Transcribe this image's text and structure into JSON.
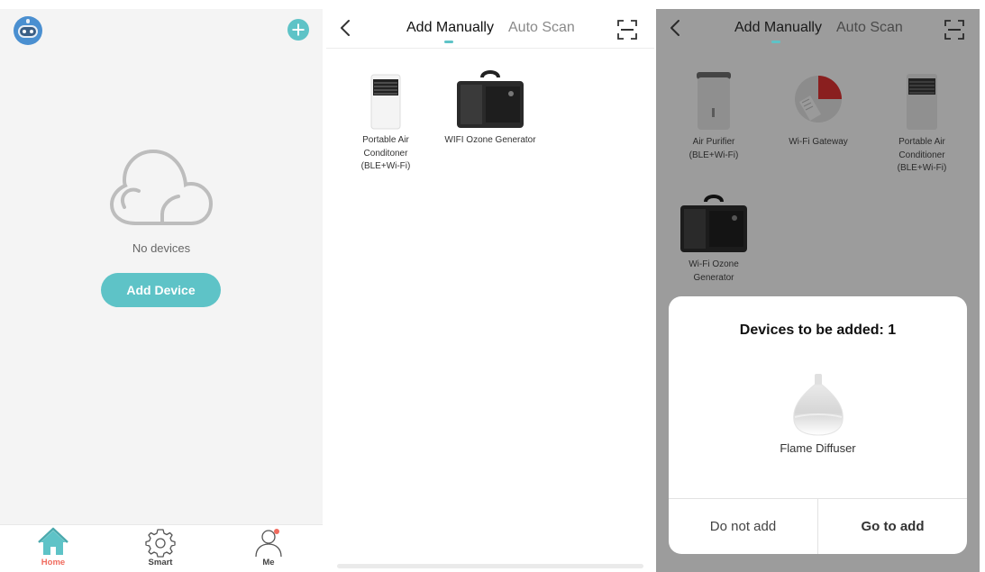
{
  "screen1": {
    "empty_text": "No devices",
    "add_device_label": "Add Device",
    "tabs": [
      {
        "label": "Home",
        "color": "#f06b5e"
      },
      {
        "label": "Smart"
      },
      {
        "label": "Me"
      }
    ],
    "icons": [
      "robot-avatar-icon",
      "plus-icon",
      "cloud-icon",
      "home-icon",
      "gear-icon",
      "person-icon"
    ]
  },
  "screen2": {
    "tabs": [
      "Add Manually",
      "Auto Scan"
    ],
    "devices": [
      {
        "name": "Portable Air Conditoner (BLE+Wi-Fi)"
      },
      {
        "name": "WIFI Ozone Generator"
      }
    ]
  },
  "screen3": {
    "tabs": [
      "Add Manually",
      "Auto Scan"
    ],
    "devices": [
      {
        "name": "Air Purifier (BLE+Wi-Fi)"
      },
      {
        "name": "Wi-Fi Gateway"
      },
      {
        "name": "Portable Air Conditioner (BLE+Wi-Fi)"
      },
      {
        "name": "Wi-Fi Ozone Generator"
      }
    ],
    "dialog": {
      "title": "Devices to be added: 1",
      "device_name": "Flame Diffuser",
      "cancel_label": "Do not add",
      "confirm_label": "Go to add"
    }
  },
  "colors": {
    "accent": "#5ec3c7",
    "home_active": "#f06b5e",
    "overlay": "#9c9c9c"
  }
}
